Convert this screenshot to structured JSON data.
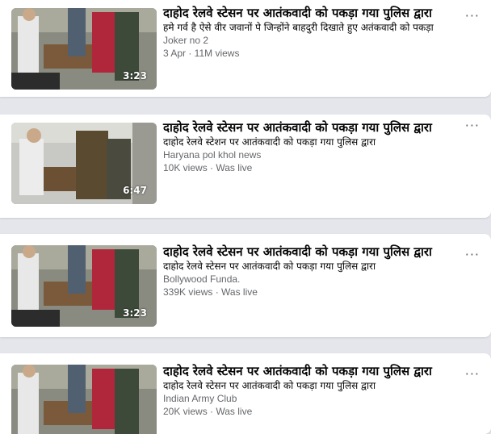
{
  "videos": [
    {
      "title": "दाहोद रेलवे स्टेसन पर आतंकवादी को पकड़ा गया पुलिस द्वारा",
      "description": "हमे गर्व है ऐसे वीर जवानों पे जिन्होंने बाहदुरी दिखाते हुए अतंकवादी को पकड़ा",
      "channel": "Joker no 2",
      "meta": "3 Apr · 11M views",
      "duration": "3:23",
      "more": "···"
    },
    {
      "title": "दाहोद रेलवे स्टेसन पर आतंकवादी को पकड़ा गया पुलिस द्वारा",
      "description": "दाहोद रेलवे स्टेशन पर आतंकवादी को पकड़ा गया पुलिस द्वारा",
      "channel": "Haryana pol khol news",
      "meta": "10K views · Was live",
      "duration": "6:47",
      "more": "···"
    },
    {
      "title": "दाहोद रेलवे स्टेसन पर आतंकवादी को पकड़ा गया पुलिस द्वारा",
      "description": "दाहोद रेलवे स्टेसन पर आतंकवादी को पकड़ा गया पुलिस द्वारा",
      "channel": "Bollywood Funda.",
      "meta": "339K views · Was live",
      "duration": "3:23",
      "more": "···"
    },
    {
      "title": "दाहोद रेलवे स्टेसन पर आतंकवादी को पकड़ा गया पुलिस द्वारा",
      "description": "दाहोद रेलवे स्टेसन पर आतंकवादी को पकड़ा गया पुलिस द्वारा",
      "channel": "Indian Army Club",
      "meta": "20K views · Was live",
      "duration": "",
      "more": "···"
    }
  ]
}
